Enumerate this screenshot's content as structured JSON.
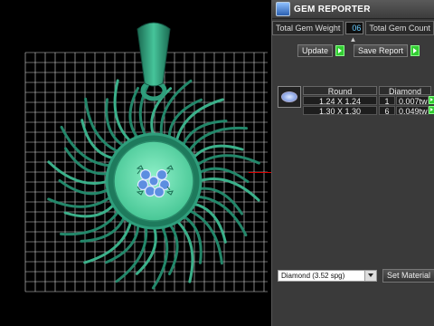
{
  "panel": {
    "title": "GEM REPORTER",
    "total_weight_label": "Total Gem Weight",
    "total_weight_value": "06",
    "total_count_label": "Total Gem Count",
    "update_label": "Update",
    "save_report_label": "Save Report"
  },
  "gem_table": {
    "headers": [
      "Round",
      "Diamond"
    ],
    "rows": [
      {
        "size": "1.24 X 1.24",
        "count": "1",
        "weight": "0.007tw"
      },
      {
        "size": "1.30 X 1.30",
        "count": "6",
        "weight": "0.049tw"
      }
    ]
  },
  "material": {
    "selected": "Diamond    (3.52 spg)",
    "set_label": "Set Material"
  },
  "colors": {
    "jewel_green": "#2f9e7c",
    "grid": "#d8d8d8",
    "panel_bg": "#3a3a3a",
    "accent_go": "#33cc33"
  }
}
